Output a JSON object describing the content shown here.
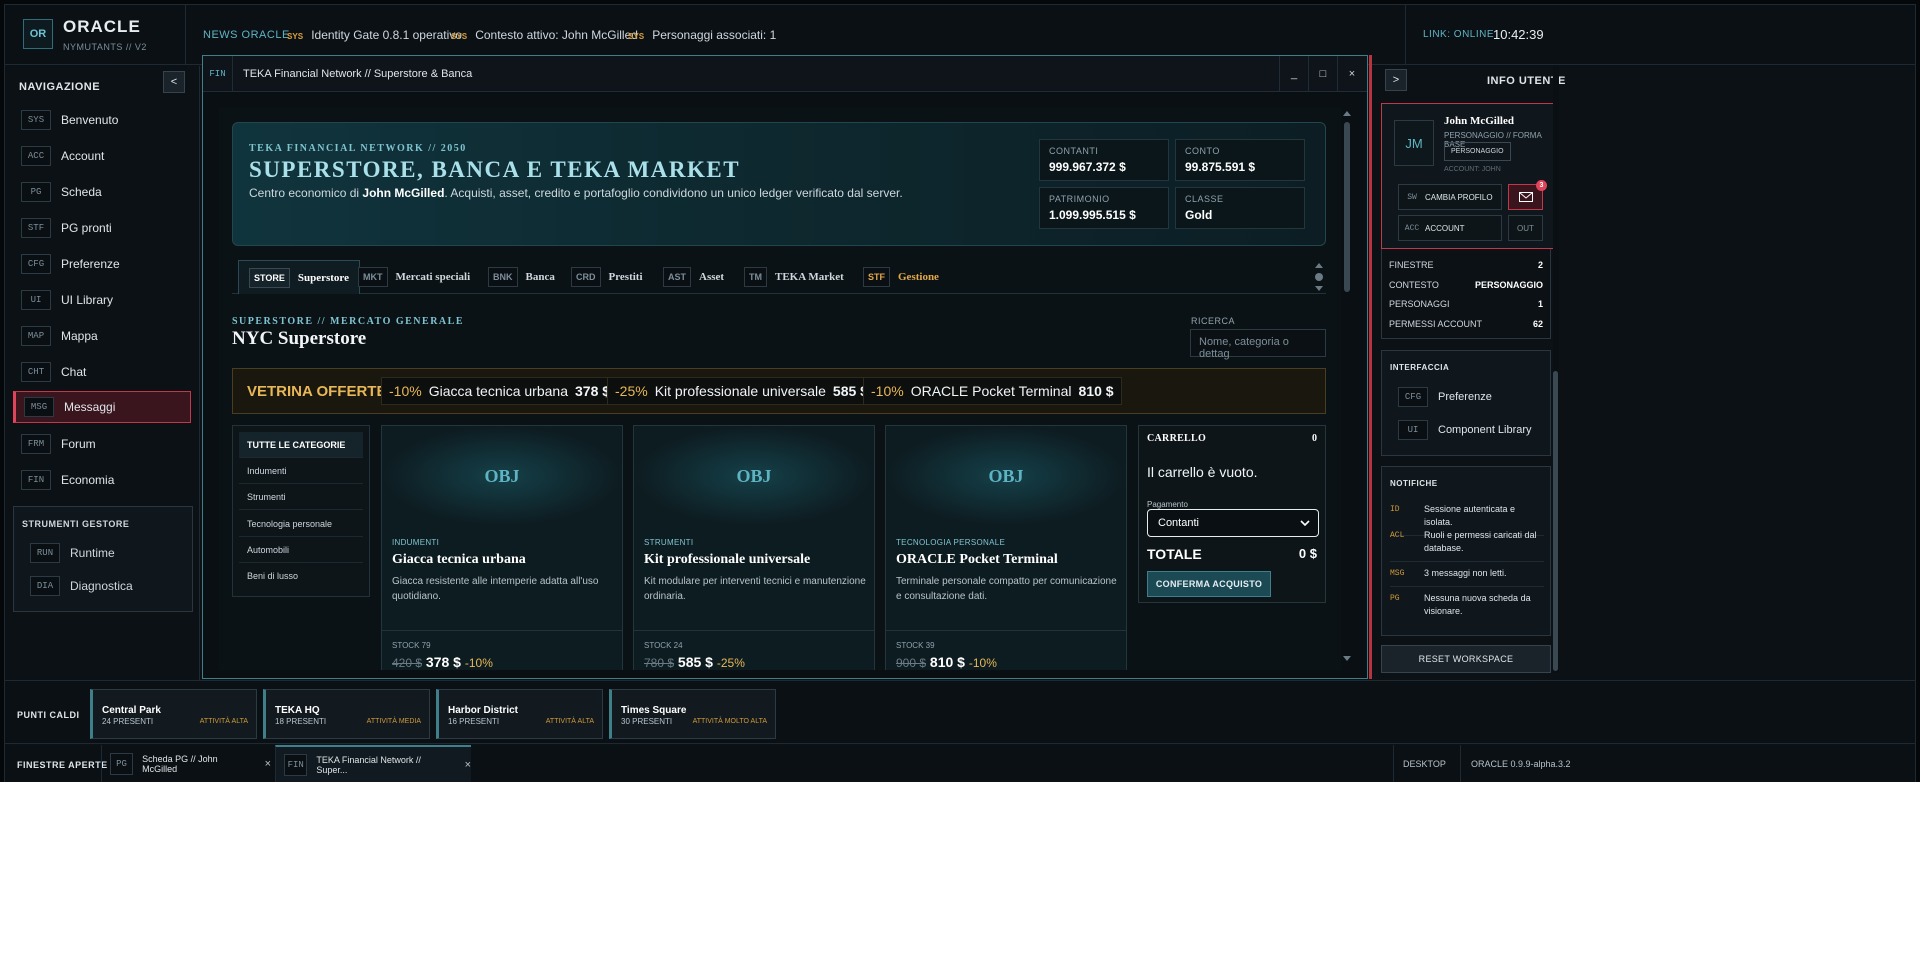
{
  "topbar": {
    "logo_abbr": "OR",
    "app_name": "ORACLE",
    "app_sub": "NYMUTANTS // V2",
    "news_label": "NEWS ORACLE",
    "news": [
      {
        "tag": "SYS",
        "text": "Identity Gate 0.8.1 operativo"
      },
      {
        "tag": "SYS",
        "text": "Contesto attivo: John McGilled"
      },
      {
        "tag": "SYS",
        "text": "Personaggi associati: 1"
      }
    ],
    "link_status": "LINK: ONLINE",
    "clock": "10:42:39"
  },
  "nav": {
    "title": "NAVIGAZIONE",
    "collapse": "<",
    "items": [
      {
        "tag": "SYS",
        "label": "Benvenuto"
      },
      {
        "tag": "ACC",
        "label": "Account"
      },
      {
        "tag": "PG",
        "label": "Scheda"
      },
      {
        "tag": "STF",
        "label": "PG pronti"
      },
      {
        "tag": "CFG",
        "label": "Preferenze"
      },
      {
        "tag": "UI",
        "label": "UI Library"
      },
      {
        "tag": "MAP",
        "label": "Mappa"
      },
      {
        "tag": "CHT",
        "label": "Chat"
      },
      {
        "tag": "MSG",
        "label": "Messaggi"
      },
      {
        "tag": "FRM",
        "label": "Forum"
      },
      {
        "tag": "FIN",
        "label": "Economia"
      }
    ],
    "tools_title": "STRUMENTI GESTORE",
    "tools": [
      {
        "tag": "RUN",
        "label": "Runtime"
      },
      {
        "tag": "DIA",
        "label": "Diagnostica"
      }
    ]
  },
  "window": {
    "tag": "FIN",
    "title": "TEKA Financial Network // Superstore & Banca",
    "min": "_",
    "max": "□",
    "close": "×",
    "hero": {
      "kicker": "TEKA FINANCIAL NETWORK // 2050",
      "title": "SUPERSTORE, BANCA E TEKA MARKET",
      "desc_pre": "Centro economico di ",
      "desc_name": "John McGilled",
      "desc_post": ". Acquisti, asset, credito e portafoglio condividono un unico ledger verificato dal server.",
      "stats": [
        {
          "k": "CONTANTI",
          "v": "999.967.372 $"
        },
        {
          "k": "CONTO",
          "v": "99.875.591 $"
        },
        {
          "k": "PATRIMONIO",
          "v": "1.099.995.515 $"
        },
        {
          "k": "CLASSE",
          "v": "Gold"
        }
      ]
    },
    "tabs": [
      {
        "tag": "STORE",
        "label": "Superstore"
      },
      {
        "tag": "MKT",
        "label": "Mercati speciali"
      },
      {
        "tag": "BNK",
        "label": "Banca"
      },
      {
        "tag": "CRD",
        "label": "Prestiti"
      },
      {
        "tag": "AST",
        "label": "Asset"
      },
      {
        "tag": "TM",
        "label": "TEKA Market"
      },
      {
        "tag": "STF",
        "label": "Gestione"
      }
    ],
    "section_kicker": "SUPERSTORE // MERCATO GENERALE",
    "section_title": "NYC Superstore",
    "search_label": "RICERCA",
    "search_placeholder": "Nome, categoria o dettag",
    "offers_title": "VETRINA OFFERTE",
    "offers": [
      {
        "disc": "-10%",
        "name": "Giacca tecnica urbana",
        "price": "378 $"
      },
      {
        "disc": "-25%",
        "name": "Kit professionale universale",
        "price": "585 $"
      },
      {
        "disc": "-10%",
        "name": "ORACLE Pocket Terminal",
        "price": "810 $"
      }
    ],
    "categories": [
      "TUTTE LE CATEGORIE",
      "Indumenti",
      "Strumenti",
      "Tecnologia personale",
      "Automobili",
      "Beni di lusso"
    ],
    "products": [
      {
        "img": "OBJ",
        "cat": "INDUMENTI",
        "name": "Giacca tecnica urbana",
        "desc": "Giacca resistente alle intemperie adatta all'uso quotidiano.",
        "stock": "STOCK 79",
        "old": "420 $",
        "price": "378 $",
        "pct": "-10%"
      },
      {
        "img": "OBJ",
        "cat": "STRUMENTI",
        "name": "Kit professionale universale",
        "desc": "Kit modulare per interventi tecnici e manutenzione ordinaria.",
        "stock": "STOCK 24",
        "old": "780 $",
        "price": "585 $",
        "pct": "-25%"
      },
      {
        "img": "OBJ",
        "cat": "TECNOLOGIA PERSONALE",
        "name": "ORACLE Pocket Terminal",
        "desc": "Terminale personale compatto per comunicazione e consultazione dati.",
        "stock": "STOCK 39",
        "old": "900 $",
        "price": "810 $",
        "pct": "-10%"
      }
    ],
    "cart": {
      "title": "CARRELLO",
      "count": "0",
      "empty": "Il carrello è vuoto.",
      "pay_label": "Pagamento",
      "pay_value": "Contanti",
      "total_label": "TOTALE",
      "total_value": "0 $",
      "confirm": "CONFERMA ACQUISTO"
    }
  },
  "user": {
    "panel_title": "INFO UTENTE",
    "expand": ">",
    "avatar": "JM",
    "name": "John McGilled",
    "role": "PERSONAGGIO // FORMA BASE",
    "badge": "PERSONAGGIO",
    "account": "ACCOUNT: JOHN",
    "switch_tag": "SW",
    "switch_label": "CAMBIA PROFILO",
    "mail_count": "3",
    "acc_tag": "ACC",
    "acc_label": "ACCOUNT",
    "out": "OUT",
    "stats": [
      {
        "k": "FINESTRE",
        "v": "2"
      },
      {
        "k": "CONTESTO",
        "v": "PERSONAGGIO"
      },
      {
        "k": "PERSONAGGI",
        "v": "1"
      },
      {
        "k": "PERMESSI ACCOUNT",
        "v": "62"
      }
    ],
    "interface_title": "INTERFACCIA",
    "interface": [
      {
        "tag": "CFG",
        "label": "Preferenze"
      },
      {
        "tag": "UI",
        "label": "Component Library"
      }
    ],
    "notif_title": "NOTIFICHE",
    "notifications": [
      {
        "tag": "ID",
        "text": "Sessione autenticata e isolata."
      },
      {
        "tag": "ACL",
        "text": "Ruoli e permessi caricati dal database."
      },
      {
        "tag": "MSG",
        "text": "3 messaggi non letti."
      },
      {
        "tag": "PG",
        "text": "Nessuna nuova scheda da visionare."
      }
    ],
    "reset": "RESET WORKSPACE"
  },
  "hotspots": {
    "label": "PUNTI CALDI",
    "items": [
      {
        "name": "Central Park",
        "people": "24 PRESENTI",
        "activity": "ATTIVITÀ ALTA"
      },
      {
        "name": "TEKA HQ",
        "people": "18 PRESENTI",
        "activity": "ATTIVITÀ MEDIA"
      },
      {
        "name": "Harbor District",
        "people": "16 PRESENTI",
        "activity": "ATTIVITÀ ALTA"
      },
      {
        "name": "Times Square",
        "people": "30 PRESENTI",
        "activity": "ATTIVITÀ MOLTO ALTA"
      }
    ]
  },
  "taskbar": {
    "label": "FINESTRE APERTE",
    "windows": [
      {
        "tag": "PG",
        "title": "Scheda PG // John McGilled"
      },
      {
        "tag": "FIN",
        "title": "TEKA Financial Network // Super..."
      }
    ],
    "close": "×",
    "desktop": "DESKTOP",
    "version": "ORACLE 0.9.9-alpha.3.2"
  }
}
